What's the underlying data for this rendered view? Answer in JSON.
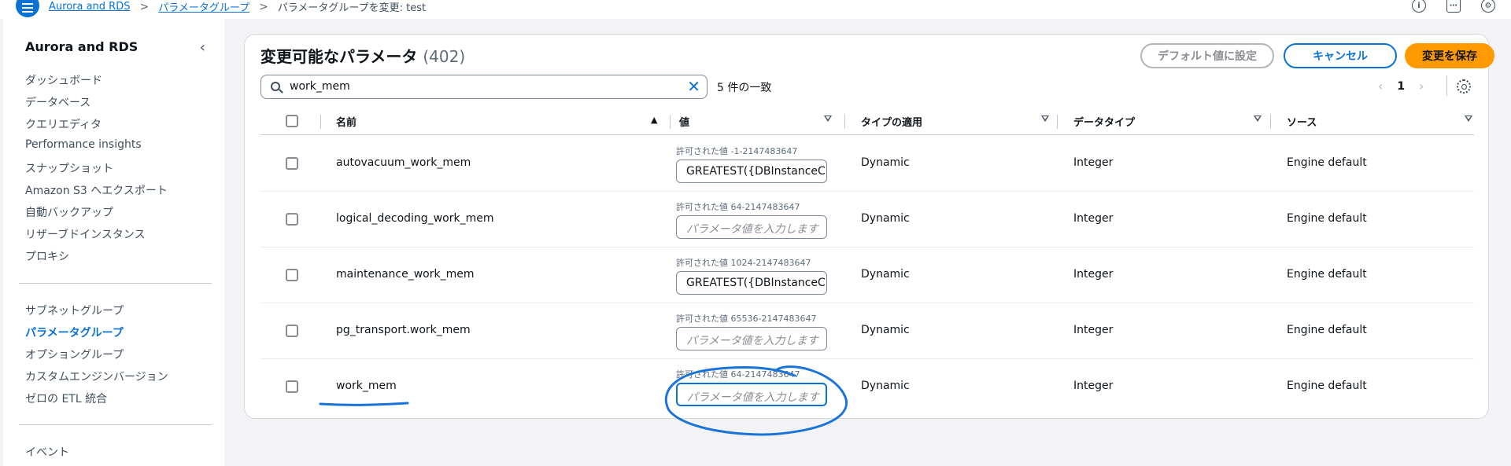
{
  "breadcrumb": {
    "items": [
      "Aurora and RDS",
      "パラメータグループ"
    ],
    "current": "パラメータグループを変更: test"
  },
  "sidebar": {
    "title": "Aurora and RDS",
    "group1": [
      "ダッシュボード",
      "データベース",
      "クエリエディタ",
      "Performance insights",
      "スナップショット",
      "Amazon S3 へエクスポート",
      "自動バックアップ",
      "リザーブドインスタンス",
      "プロキシ"
    ],
    "group2": [
      "サブネットグループ",
      "パラメータグループ",
      "オプショングループ",
      "カスタムエンジンバージョン",
      "ゼロの ETL 統合"
    ],
    "active": "パラメータグループ",
    "group3": [
      "イベント"
    ]
  },
  "panel": {
    "title": "変更可能なパラメータ",
    "count": "(402)",
    "buttons": {
      "default": "デフォルト値に設定",
      "cancel": "キャンセル",
      "save": "変更を保存"
    },
    "search": {
      "value": "work_mem",
      "match_text": "5 件の一致"
    },
    "pager": {
      "prev": "‹",
      "page": "1",
      "next": "›"
    }
  },
  "table": {
    "columns": [
      "名前",
      "値",
      "タイプの適用",
      "データタイプ",
      "ソース"
    ],
    "rows": [
      {
        "name": "autovacuum_work_mem",
        "allowed": "許可された値 -1-2147483647",
        "value": "GREATEST({DBInstanceCla",
        "placeholder": false,
        "apply_type": "Dynamic",
        "data_type": "Integer",
        "source": "Engine default"
      },
      {
        "name": "logical_decoding_work_mem",
        "allowed": "許可された値 64-2147483647",
        "value": "パラメータ値を入力します",
        "placeholder": true,
        "apply_type": "Dynamic",
        "data_type": "Integer",
        "source": "Engine default"
      },
      {
        "name": "maintenance_work_mem",
        "allowed": "許可された値 1024-2147483647",
        "value": "GREATEST({DBInstanceCla",
        "placeholder": false,
        "apply_type": "Dynamic",
        "data_type": "Integer",
        "source": "Engine default"
      },
      {
        "name": "pg_transport.work_mem",
        "allowed": "許可された値 65536-2147483647",
        "value": "パラメータ値を入力します",
        "placeholder": true,
        "apply_type": "Dynamic",
        "data_type": "Integer",
        "source": "Engine default"
      },
      {
        "name": "work_mem",
        "allowed": "許可された値 64-2147483647",
        "value": "パラメータ値を入力します",
        "placeholder": true,
        "apply_type": "Dynamic",
        "data_type": "Integer",
        "source": "Engine default"
      }
    ]
  },
  "colors": {
    "accent": "#0972d3",
    "save": "#ff9900",
    "annotation": "#1a73d9"
  }
}
